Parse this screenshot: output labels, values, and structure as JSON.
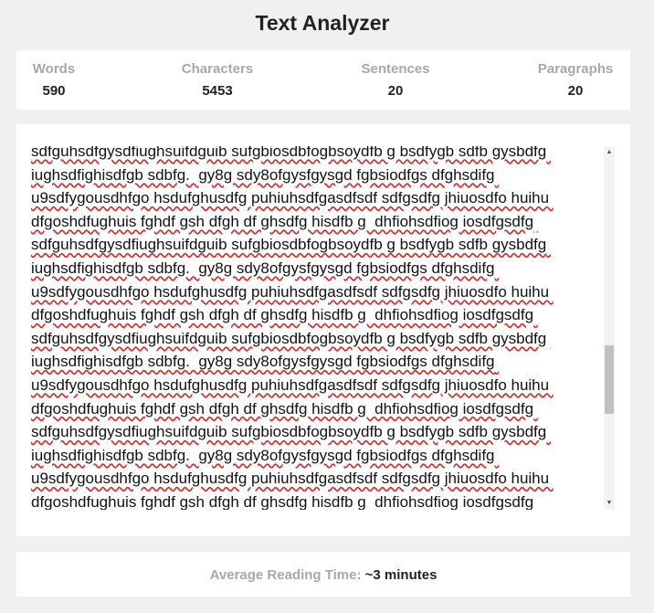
{
  "app": {
    "title": "Text Analyzer"
  },
  "stats": {
    "words": {
      "label": "Words",
      "value": "590"
    },
    "characters": {
      "label": "Characters",
      "value": "5453"
    },
    "sentences": {
      "label": "Sentences",
      "value": "20"
    },
    "paragraphs": {
      "label": "Paragraphs",
      "value": "20"
    }
  },
  "editor": {
    "text": "sdfguhsdfgysdfiughsuifdguib sufgbiosdbfogbsoydfb g bsdfygb sdfb gysbdfg iughsdfighisdfgb sdbfg.  gy8g sdy8ofgysfgysgd fgbsiodfgs dfghsdifg u9sdfygousdhfgo hsdufghusdfg puhiuhsdfgasdfsdf sdfgsdfg jhiuosdfo huihu dfgoshdfughuis fghdf gsh dfgh df ghsdfg hisdfb g  dhfiohsdfiog iosdfgsdfg sdfguhsdfgysdfiughsuifdguib sufgbiosdbfogbsoydfb g bsdfygb sdfb gysbdfg iughsdfighisdfgb sdbfg.  gy8g sdy8ofgysfgysgd fgbsiodfgs dfghsdifg u9sdfygousdhfgo hsdufghusdfg puhiuhsdfgasdfsdf sdfgsdfg jhiuosdfo huihu dfgoshdfughuis fghdf gsh dfgh df ghsdfg hisdfb g  dhfiohsdfiog iosdfgsdfg sdfguhsdfgysdfiughsuifdguib sufgbiosdbfogbsoydfb g bsdfygb sdfb gysbdfg iughsdfighisdfgb sdbfg.  gy8g sdy8ofgysfgysgd fgbsiodfgs dfghsdifg u9sdfygousdhfgo hsdufghusdfg puhiuhsdfgasdfsdf sdfgsdfg jhiuosdfo huihu dfgoshdfughuis fghdf gsh dfgh df ghsdfg hisdfb g  dhfiohsdfiog iosdfgsdfg sdfguhsdfgysdfiughsuifdguib sufgbiosdbfogbsoydfb g bsdfygb sdfb gysbdfg iughsdfighisdfgb sdbfg.  gy8g sdy8ofgysfgysgd fgbsiodfgs dfghsdifg u9sdfygousdhfgo hsdufghusdfg puhiuhsdfgasdfsdf sdfgsdfg jhiuosdfo huihu dfgoshdfughuis fghdf gsh dfgh df ghsdfg hisdfb g  dhfiohsdfiog iosdfgsdfg",
    "scroll_position": 0.62
  },
  "reading_time": {
    "label": "Average Reading Time:",
    "value": "~3 minutes"
  },
  "icons": {
    "scroll_up": "scroll-up-arrow-icon",
    "scroll_down": "scroll-down-arrow-icon"
  },
  "colors": {
    "background": "#f0f0f0",
    "card": "#ffffff",
    "label": "#a8a8a8",
    "value": "#222222",
    "spellcheck": "#d32f2f"
  }
}
